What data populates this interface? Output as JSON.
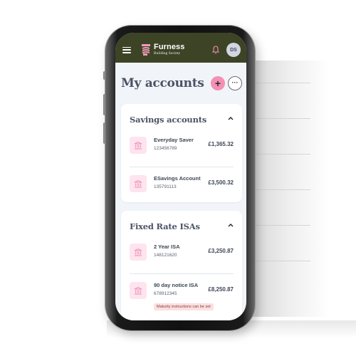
{
  "app": {
    "brand_name": "Furness",
    "brand_subtitle": "Building Society",
    "avatar_initials": "DS",
    "colors": {
      "header_bg": "#3d4426",
      "accent_pink": "#f58fb4",
      "icon_bg": "#fde4ee",
      "screen_bg": "#f1f4f8",
      "text_dark": "#4a5264",
      "badge_bg": "#fbe0e0"
    }
  },
  "header": {
    "menu_icon": "hamburger-menu-icon",
    "bell_icon": "bell-icon"
  },
  "page": {
    "title": "My accounts",
    "add_label": "+",
    "more_label": "···"
  },
  "sections": [
    {
      "title": "Savings accounts",
      "accounts": [
        {
          "name": "Everyday Saver",
          "number": "123456789",
          "balance": "£1,365.32"
        },
        {
          "name": "ESavings Account",
          "number": "135791113",
          "balance": "£3,500.32"
        }
      ]
    },
    {
      "title": "Fixed Rate ISAs",
      "accounts": [
        {
          "name": "2 Year ISA",
          "number": "148121620",
          "balance": "£3,250.87"
        },
        {
          "name": "90 day notice ISA",
          "number": "678912345",
          "balance": "£8,250.87",
          "badge": "Maturity instructions can be set"
        }
      ]
    }
  ]
}
